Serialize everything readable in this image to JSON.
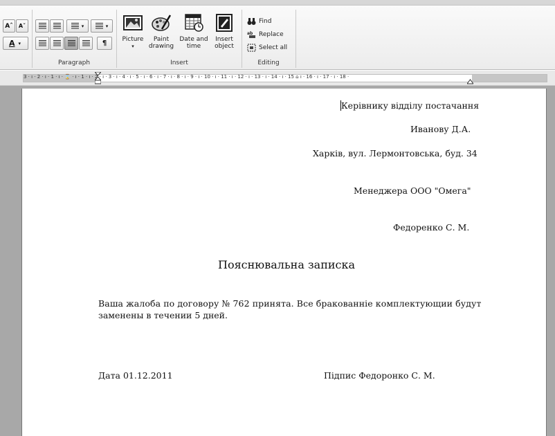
{
  "ribbon": {
    "paragraph_group_label": "Paragraph",
    "insert_group_label": "Insert",
    "editing_group_label": "Editing",
    "insert_buttons": {
      "picture": "Picture",
      "paint_drawing": "Paint drawing",
      "date_and_time": "Date and time",
      "insert_object": "Insert object"
    },
    "editing_buttons": {
      "find": "Find",
      "replace": "Replace",
      "select_all": "Select all"
    },
    "font_color_label": "A"
  },
  "ruler": {
    "labels": "3 · ı · 2 · ı · 1 · ı · ⌛ · ı · 1 · ı · 2 · ı · 3 · ı · 4 · ı · 5 · ı · 6 · ı · 7 · ı · 8 · ı · 9 · ı · 10 · ı · 11 · ı · 12 · ı · 13 · ı · 14 · ı · 15 ⌂ ı · 16 · ı · 17 · ı · 18 ·"
  },
  "document": {
    "addressee_line1": "Керівнику відділу постачання",
    "addressee_line2": "Иванову Д.А.",
    "addressee_line3": "Харків, вул. Лермонтовська, буд. 34",
    "from_line1": "Менеджера ООО  \"Омега\"",
    "from_line2": "Федоренко С. М.",
    "title": "Пояснювальна записка",
    "body_line1": "Ваша жалоба по договору № 762 принята. Все бракованніе комплектующии будут",
    "body_line2": "заменены в течении 5 дней.",
    "date": "Дата 01.12.2011",
    "signature": "Підпис  Федоронко С. М."
  },
  "colors": {
    "ribbon_bg": "#ececec",
    "doc_bg": "#a8a8a8",
    "page": "#ffffff"
  }
}
